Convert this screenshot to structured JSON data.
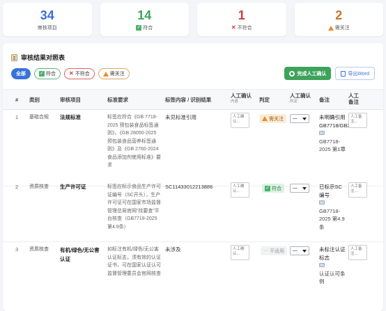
{
  "stats": [
    {
      "value": "34",
      "label": "审核项目",
      "icon": "",
      "color": "#3a6fd8"
    },
    {
      "value": "14",
      "label": "符合",
      "icon": "check-icon",
      "color": "#3aa55e"
    },
    {
      "value": "1",
      "label": "不符合",
      "icon": "x-icon",
      "color": "#d63a3a"
    },
    {
      "value": "2",
      "label": "需关注",
      "icon": "warning-icon",
      "color": "#c8782a"
    }
  ],
  "panel": {
    "title": "审核结果对照表",
    "filters": {
      "all": "全部",
      "ok": "符合",
      "bad": "不符合",
      "warn": "需关注"
    },
    "confirm_label": "完成人工确认",
    "export_label": "导出Word"
  },
  "columns": {
    "idx": "#",
    "cat": "类别",
    "item": "审核项目",
    "std": "标准要求",
    "content": "标签内容 / 识别结果",
    "manual": "人工确认",
    "manual_sub": "内容",
    "judge": "判定",
    "manual2": "人工确认",
    "manual2_sub": "判定",
    "note": "备注",
    "note2": "人工备注"
  },
  "rows": [
    {
      "idx": "1",
      "cat": "基础合规",
      "item": "法规标准",
      "std": "标签应符合《GB 7718-2025 预包装食品标签通则》、《GB 28050-2025 预包装食品营养标签通则》及《GB 2760-2024 食品添加剂使用标准》要求",
      "content": "未见标准引用",
      "confirm_placeholder": "人工确认...",
      "status": "需关注",
      "status_type": "warn",
      "select": "—",
      "note_main": "未明确引用GB7718/GB28050",
      "note_ref": "GB7718-2025 第1章",
      "remark_placeholder": "人工备注..."
    },
    {
      "idx": "2",
      "cat": "资质核查",
      "item": "生产许可证",
      "std": "标签应标示食品生产许可证编号（SC开头），生产许可证可在国家市场监督管理总局官网“找要查”平台核查（GB7718-2025 第4.9条）",
      "content": "SC11433012213886",
      "confirm_placeholder": "人工确认...",
      "status": "符合",
      "status_type": "ok",
      "select": "—",
      "note_main": "已标示SC编号",
      "note_ref": "GB7718-2025 第4.9条",
      "remark_placeholder": "人工备注..."
    },
    {
      "idx": "3",
      "cat": "资质核查",
      "item": "有机/绿色/无公害认证",
      "std": "如标注有机/绿色/无公害认证标志，须有效的认证证书，可在国家认证认可监督管理委员会官网核查",
      "content": "未涉及",
      "confirm_placeholder": "人工确认...",
      "status": "不适用",
      "status_type": "na",
      "select": "—",
      "note_main": "未标注认证标志",
      "note_ref": "认证认可条例",
      "remark_placeholder": "人工备注..."
    }
  ]
}
